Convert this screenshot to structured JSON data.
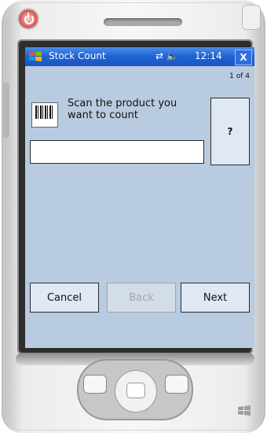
{
  "titlebar": {
    "title": "Stock Count",
    "time": "12:14",
    "close_label": "X",
    "connectivity_icon": "connectivity-icon",
    "volume_icon": "volume-icon"
  },
  "wizard": {
    "page_counter": "1 of 4",
    "prompt_line1": "Scan the product you",
    "prompt_line2": "want to count",
    "help_label": "?",
    "scan_value": ""
  },
  "buttons": {
    "cancel": "Cancel",
    "back": "Back",
    "next": "Next"
  },
  "colors": {
    "screen_bg": "#b9cbe0",
    "title_bar": "#1f62d1",
    "button_bg": "#dfe8f3"
  }
}
